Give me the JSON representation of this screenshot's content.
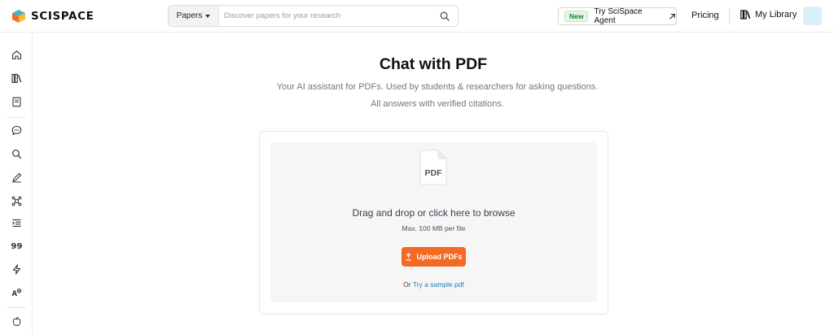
{
  "brand": {
    "name": "SCISPACE",
    "colors": {
      "teal": "#3fb7c9",
      "orange": "#f46a25",
      "yellow": "#f5c12e"
    }
  },
  "search": {
    "type_label": "Papers",
    "placeholder": "Discover papers for your research",
    "icon": "search-icon"
  },
  "header": {
    "agent_badge": "New",
    "agent_label": "Try SciSpace Agent",
    "pricing": "Pricing",
    "library": "My Library"
  },
  "sidebar": {
    "items": [
      {
        "icon": "home-icon"
      },
      {
        "icon": "library-icon"
      },
      {
        "icon": "notebook-icon"
      },
      {
        "icon": "chat-icon"
      },
      {
        "icon": "search-icon"
      },
      {
        "icon": "write-icon"
      },
      {
        "icon": "network-icon"
      },
      {
        "icon": "list-indent-icon"
      },
      {
        "icon": "quote-icon"
      },
      {
        "icon": "lightning-icon"
      },
      {
        "icon": "paraphrase-icon"
      },
      {
        "icon": "apple-icon"
      }
    ]
  },
  "main": {
    "title": "Chat with PDF",
    "subtitle": "Your AI assistant for PDFs. Used by students & researchers for asking questions. All answers with verified citations.",
    "pdf_icon_label": "PDF",
    "drop_text": "Drag and drop or click here to browse",
    "max_text": "Max. 100 MB per file",
    "upload_label": "Upload PDFs",
    "sample_prefix": "Or",
    "sample_link": "Try a sample pdf"
  }
}
